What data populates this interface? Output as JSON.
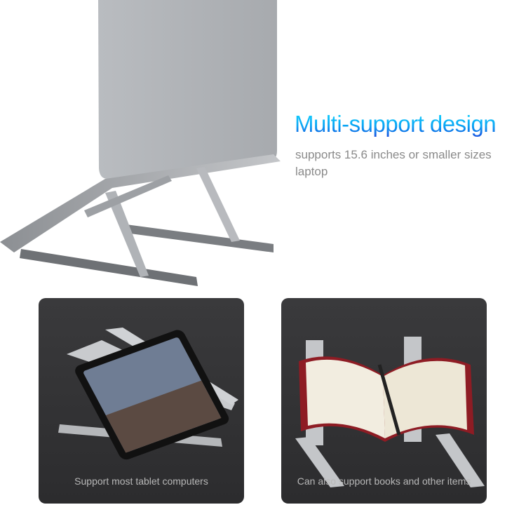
{
  "hero": {
    "headline": "Multi-support design",
    "subtitle": "supports 15.6 inches or smaller sizes laptop"
  },
  "panels": [
    {
      "caption": "Support most tablet computers"
    },
    {
      "caption": "Can also support books and other items"
    }
  ],
  "colors": {
    "headline_top": "#18d8ff",
    "headline_bottom": "#1a4fe0",
    "subtitle": "#8a8a8a",
    "panel_bg": "#333335"
  }
}
